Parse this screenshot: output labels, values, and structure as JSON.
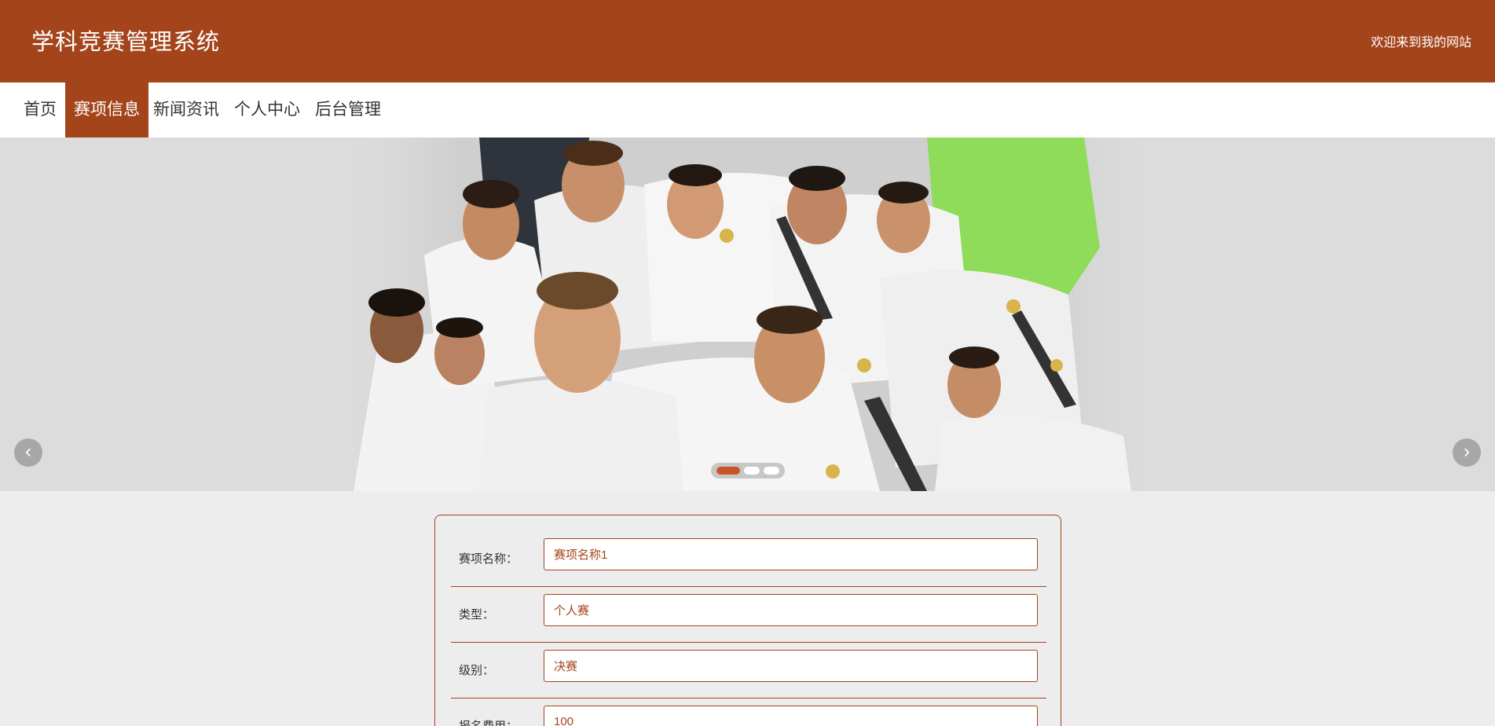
{
  "header": {
    "title": "学科竞赛管理系统",
    "welcome": "欢迎来到我的网站"
  },
  "nav": {
    "items": [
      {
        "label": "首页"
      },
      {
        "label": "赛项信息"
      },
      {
        "label": "新闻资讯"
      },
      {
        "label": "个人中心"
      },
      {
        "label": "后台管理"
      }
    ]
  },
  "carousel": {
    "prev_label": "‹",
    "next_label": "›",
    "active_slide": 1,
    "slide_count": 3
  },
  "form": {
    "fields": [
      {
        "label": "赛项名称：",
        "value": "赛项名称1"
      },
      {
        "label": "类型：",
        "value": "个人赛"
      },
      {
        "label": "级别：",
        "value": "决赛"
      },
      {
        "label": "报名费用：",
        "value": "100"
      }
    ]
  },
  "colors": {
    "brand": "#a3441b",
    "page_bg": "#ededed"
  }
}
